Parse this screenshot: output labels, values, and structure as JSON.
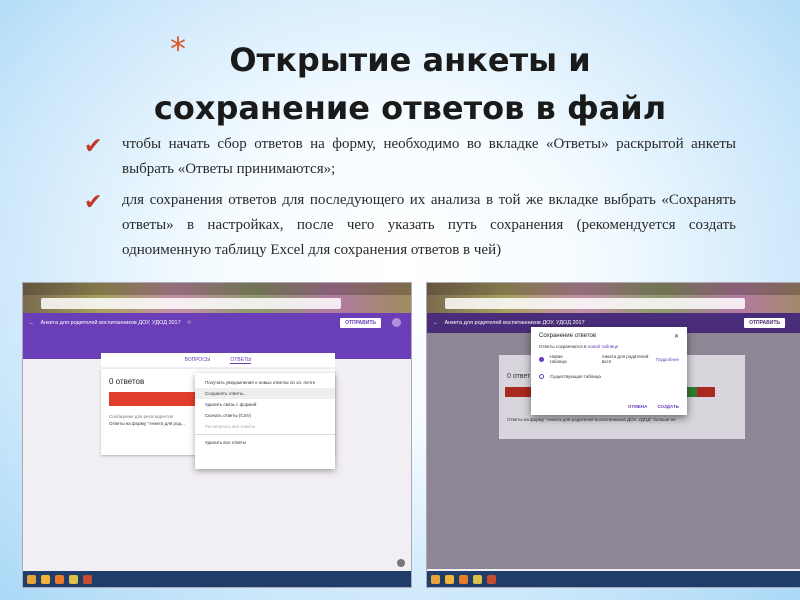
{
  "title": {
    "star": "*",
    "line1": "Открытие анкеты и",
    "line2": "сохранение ответов в файл"
  },
  "bullets": [
    {
      "icon": "check-icon",
      "text": "чтобы начать сбор ответов на форму, необходимо во вкладке «Ответы» раскрытой анкеты выбрать «Ответы принимаются»;"
    },
    {
      "icon": "check-icon",
      "text": "для сохранения ответов для последующего их анализа в той же вкладке выбрать «Сохранять ответы» в настройках, после чего указать путь сохранения (рекомендуется создать одноименную таблицу Excel для сохранения ответов в чей)"
    }
  ],
  "left_screenshot": {
    "form_title": "Анкета для родителей воспитанников ДОУ, УДОД 2017",
    "send_button": "ОТПРАВИТЬ",
    "tab_questions": "ВОПРОСЫ",
    "tab_answers": "ОТВЕТЫ",
    "count": "0 ответов",
    "message_title": "Сообщение для респондентов",
    "message": "Ответы на форму \"Анкета для род...",
    "menu": [
      "Получать уведомления о новых ответах по эл. почте",
      "Сохранять ответы...",
      "Удалить связь с формой",
      "Скачать ответы (CSV)",
      "Распечатать все ответы",
      "Удалить все ответы"
    ]
  },
  "right_screenshot": {
    "form_title": "Анкета для родителей воспитанников ДОУ, УДОД 2017",
    "send_button": "ОТПРАВИТЬ",
    "count": "0 ответ",
    "message": "Ответы на форму \"Анкета для родителей воспитанников ДОУ, УДОД\" больше не",
    "dialog": {
      "title": "Сохранение ответов",
      "subtitle": "Ответы сохраняются в",
      "subtitle_link": "новой таблице",
      "option_new": "Новая таблица",
      "option_new_value": "Анкета для родителей восп",
      "option_new_link": "Подробнее",
      "option_existing": "Существующая таблица",
      "cancel": "ОТМЕНА",
      "create": "СОЗДАТЬ"
    }
  },
  "colors": {
    "accent": "#6a3eb7",
    "title_star": "#e0562a",
    "bullet_check": "#c0392b"
  }
}
